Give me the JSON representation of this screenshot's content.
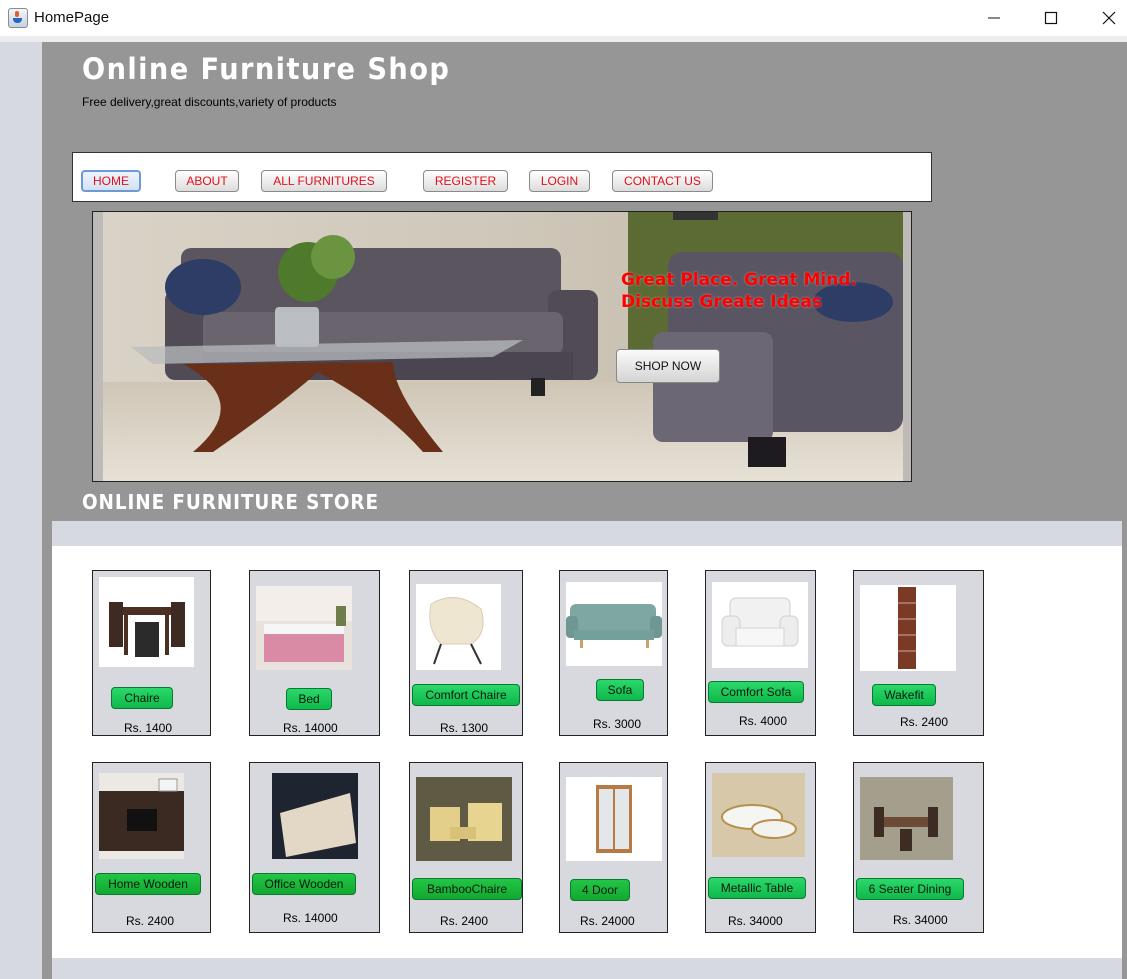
{
  "window": {
    "title": "HomePage"
  },
  "header": {
    "title": "Online Furniture Shop",
    "subtitle": "Free delivery,great discounts,variety of products"
  },
  "nav": {
    "items": [
      "HOME",
      "ABOUT",
      "ALL FURNITURES",
      "REGISTER",
      "LOGIN",
      "CONTACT US"
    ],
    "active": "HOME"
  },
  "banner": {
    "line1": "Great Place. Great Mind.",
    "line2": "Discuss Greate Ideas",
    "button": "SHOP NOW"
  },
  "store_heading": "ONLINE FURNITURE STORE",
  "products": [
    {
      "name": "Chaire",
      "price": "Rs. 1400"
    },
    {
      "name": "Bed",
      "price": "Rs. 14000"
    },
    {
      "name": "Comfort Chaire",
      "price": "Rs. 1300"
    },
    {
      "name": "Sofa",
      "price": "Rs. 3000"
    },
    {
      "name": "Comfort Sofa",
      "price": "Rs. 4000"
    },
    {
      "name": "Wakefit",
      "price": "Rs. 2400"
    },
    {
      "name": "Home Wooden",
      "price": "Rs. 2400"
    },
    {
      "name": "Office Wooden",
      "price": "Rs. 14000"
    },
    {
      "name": "BambooChaire",
      "price": "Rs. 2400"
    },
    {
      "name": "4 Door",
      "price": "Rs. 24000"
    },
    {
      "name": "Metallic Table",
      "price": "Rs. 34000"
    },
    {
      "name": "6 Seater Dining",
      "price": "Rs. 34000"
    }
  ],
  "colors": {
    "nav_text": "#e0101c",
    "banner_text": "#ff0000",
    "product_button": "#1fcc5a",
    "content_bg": "#969696"
  }
}
